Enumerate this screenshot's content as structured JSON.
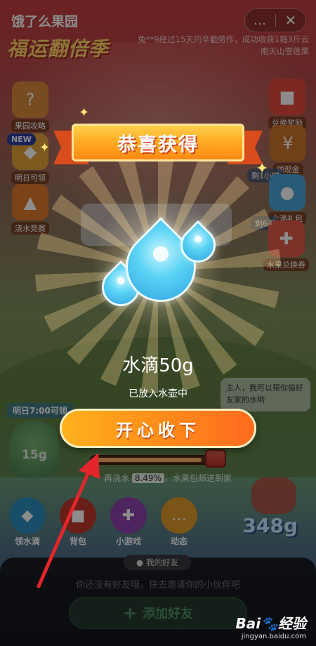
{
  "header": {
    "app_title": "饿了么果园",
    "more_icon": "…",
    "close_icon": "✕"
  },
  "logo_text": "福运翻倍季",
  "notice": "兔**9经过15天的辛勤劳作，成功收获1箱3斤云南天山雪莲果",
  "left_icons": [
    {
      "label": "果园攻略",
      "icon": "book-icon",
      "color": "#d98a3c"
    },
    {
      "label": "明日可领",
      "icon": "gift-icon",
      "color": "#e2a53a",
      "badge": "NEW"
    },
    {
      "label": "浇水竞赛",
      "icon": "trophy-icon",
      "color": "#e07b2a"
    }
  ],
  "right_icons": [
    {
      "label": "兑换奖励",
      "icon": "gift-box-icon",
      "color": "#e34b3c"
    },
    {
      "label": "领现金",
      "icon": "cash-icon",
      "color": "#d0752b"
    },
    {
      "label": "水滴礼包",
      "icon": "drop-bag-icon",
      "color": "#4aa7d8",
      "tag": "剩1小时"
    },
    {
      "label": "水果兑换券",
      "icon": "coupon-icon",
      "color": "#e45a4b",
      "tag": "剩6天"
    }
  ],
  "bubble_right": "主人，我可以帮你偷好友家的水哟",
  "tomorrow_label": "明日7:00可领",
  "jar_amount": "15g",
  "progress": {
    "percent_text": "8.49%",
    "fraction": 0.0849,
    "prefix": "再浇水",
    "suffix": "，水果包邮送到家"
  },
  "bottom_icons": [
    {
      "label": "领水滴",
      "color": "#2f8fbf"
    },
    {
      "label": "背包",
      "color": "#c0392b"
    },
    {
      "label": "小游戏",
      "color": "#8e44ad"
    },
    {
      "label": "动态",
      "color": "#e09a2b"
    }
  ],
  "kettle_amount": "348g",
  "friends": {
    "tab_label": "我的好友",
    "description": "你还没有好友哦，快去邀请你的小伙伴吧",
    "add_button": "添加好友"
  },
  "popup": {
    "title": "恭喜获得",
    "reward_name": "水滴",
    "reward_amount": "50g",
    "reward_sub": "已放入水壶中",
    "accept_button": "开心收下"
  },
  "watermark": {
    "brand": "Bai🐾经验",
    "url": "jingyan.baidu.com"
  },
  "colors": {
    "accent": "#ff8a1a",
    "ribbon": "#ffae24",
    "arrow": "#e3262b"
  }
}
